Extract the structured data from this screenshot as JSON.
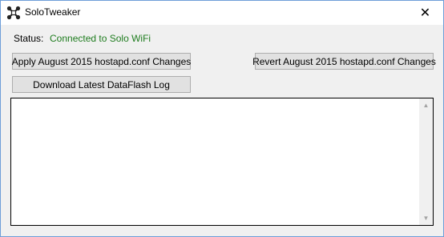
{
  "window": {
    "title": "SoloTweaker",
    "close_glyph": "✕"
  },
  "status": {
    "label": "Status:",
    "value": "Connected to Solo WiFi",
    "value_color": "#1e7c1e"
  },
  "buttons": {
    "apply_label": "Apply August 2015 hostapd.conf Changes",
    "revert_label": "Revert August 2015 hostapd.conf Changes",
    "download_label": "Download Latest DataFlash Log"
  },
  "log": {
    "content": "",
    "scroll_up_glyph": "▲",
    "scroll_down_glyph": "▼"
  },
  "icons": {
    "app": "drone-icon",
    "close": "close-icon"
  }
}
